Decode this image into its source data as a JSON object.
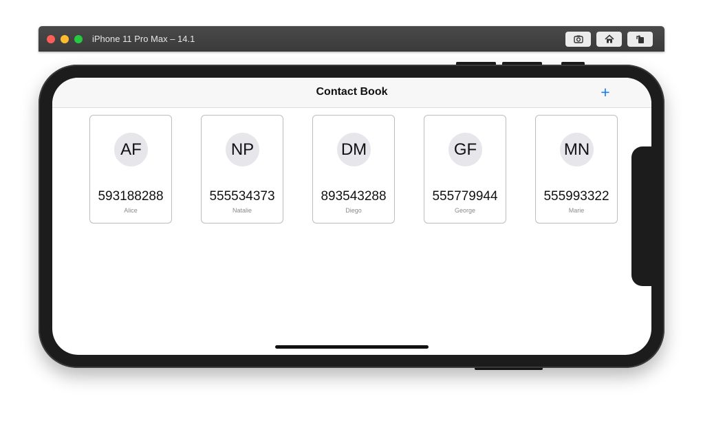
{
  "simulator": {
    "title": "iPhone 11 Pro Max – 14.1"
  },
  "app": {
    "nav_title": "Contact Book",
    "add_label": "+",
    "accent_color": "#1a7cf5"
  },
  "contacts": [
    {
      "initials": "AF",
      "phone": "593188288",
      "name": "Alice"
    },
    {
      "initials": "NP",
      "phone": "555534373",
      "name": "Natalie"
    },
    {
      "initials": "DM",
      "phone": "893543288",
      "name": "Diego"
    },
    {
      "initials": "GF",
      "phone": "555779944",
      "name": "George"
    },
    {
      "initials": "MN",
      "phone": "555993322",
      "name": "Marie"
    }
  ]
}
